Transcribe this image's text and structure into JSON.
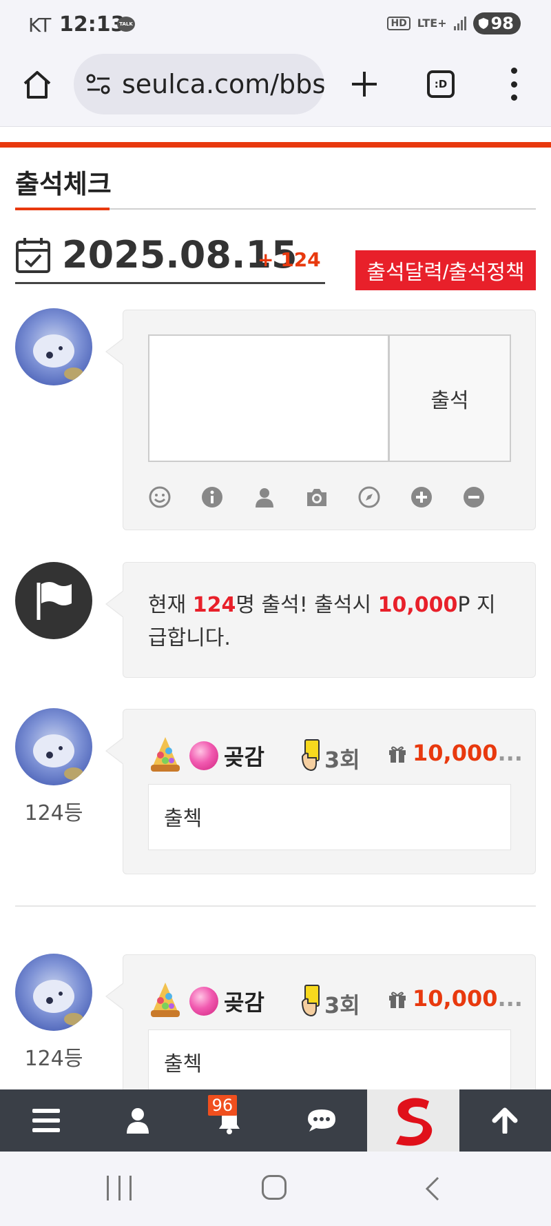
{
  "status_bar": {
    "carrier": "KT",
    "time": "12:13",
    "talk_label": "TALK",
    "hd_label": "HD",
    "network": "LTE+",
    "battery": "98"
  },
  "browser": {
    "url": "seulca.com/bbs",
    "tabs_label": ":D"
  },
  "page": {
    "tab_title": "출석체크",
    "date": "2025.08.15",
    "count_text": "+ 124",
    "policy_button": "출석달력/출석정책"
  },
  "compose": {
    "textarea_value": "",
    "submit_label": "출석",
    "tools": [
      "smile-icon",
      "info-icon",
      "user-icon",
      "camera-icon",
      "compass-icon",
      "plus-circle-icon",
      "minus-circle-icon"
    ]
  },
  "notice": {
    "prefix": "현재 ",
    "count": "124",
    "middle": "명 출석! 출석시 ",
    "points": "10,000",
    "suffix": "P 지급합니다."
  },
  "entries": [
    {
      "rank": "124등",
      "nickname": "곶감",
      "times": "3회",
      "points": "10,000",
      "ellipsis": "...",
      "comment": "출첵"
    },
    {
      "rank": "124등",
      "nickname": "곶감",
      "times": "3회",
      "points": "10,000",
      "ellipsis": "...",
      "comment": "출첵"
    }
  ],
  "bottom_nav": {
    "notification_count": "96",
    "items": [
      "menu-icon",
      "user-icon",
      "bell-icon",
      "chat-icon",
      "site-logo",
      "arrow-up-icon"
    ]
  },
  "colors": {
    "accent": "#e8390e",
    "button_red": "#e8202a",
    "nav_bg": "#3a3f47"
  }
}
